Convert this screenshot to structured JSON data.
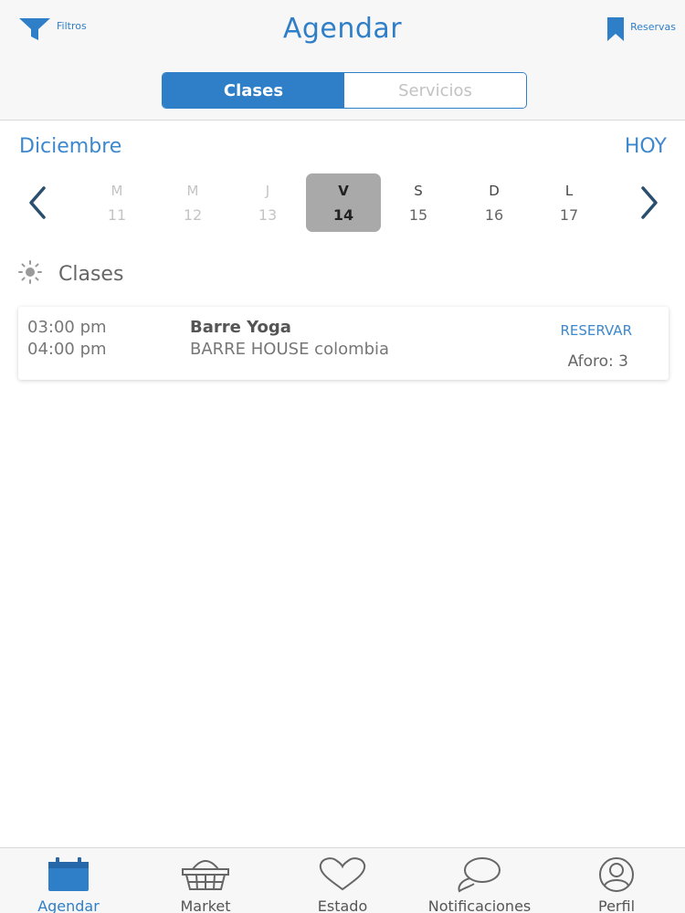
{
  "header": {
    "filters_label": "Filtros",
    "title": "Agendar",
    "reservations_label": "Reservas"
  },
  "segments": {
    "classes": "Clases",
    "services": "Servicios",
    "active": "classes"
  },
  "calendar": {
    "month": "Diciembre",
    "today_label": "HOY",
    "days": [
      {
        "weekday": "M",
        "date": "11",
        "state": "past"
      },
      {
        "weekday": "M",
        "date": "12",
        "state": "past"
      },
      {
        "weekday": "J",
        "date": "13",
        "state": "past"
      },
      {
        "weekday": "V",
        "date": "14",
        "state": "selected"
      },
      {
        "weekday": "S",
        "date": "15",
        "state": "future"
      },
      {
        "weekday": "D",
        "date": "16",
        "state": "future"
      },
      {
        "weekday": "L",
        "date": "17",
        "state": "future"
      }
    ]
  },
  "section": {
    "label": "Clases",
    "icon": "sun-icon"
  },
  "classes": [
    {
      "start": "03:00 pm",
      "end": "04:00 pm",
      "name": "Barre Yoga",
      "location": "BARRE HOUSE colombia",
      "action": "RESERVAR",
      "capacity": "Aforo: 3"
    }
  ],
  "tabs": [
    {
      "label": "Agendar",
      "icon": "calendar-icon",
      "active": true
    },
    {
      "label": "Market",
      "icon": "basket-icon",
      "active": false
    },
    {
      "label": "Estado",
      "icon": "heart-icon",
      "active": false
    },
    {
      "label": "Notificaciones",
      "icon": "chat-icon",
      "active": false
    },
    {
      "label": "Perfil",
      "icon": "user-icon",
      "active": false
    }
  ],
  "colors": {
    "accent": "#2f7fc8",
    "selected_day": "#a9a9a9"
  }
}
